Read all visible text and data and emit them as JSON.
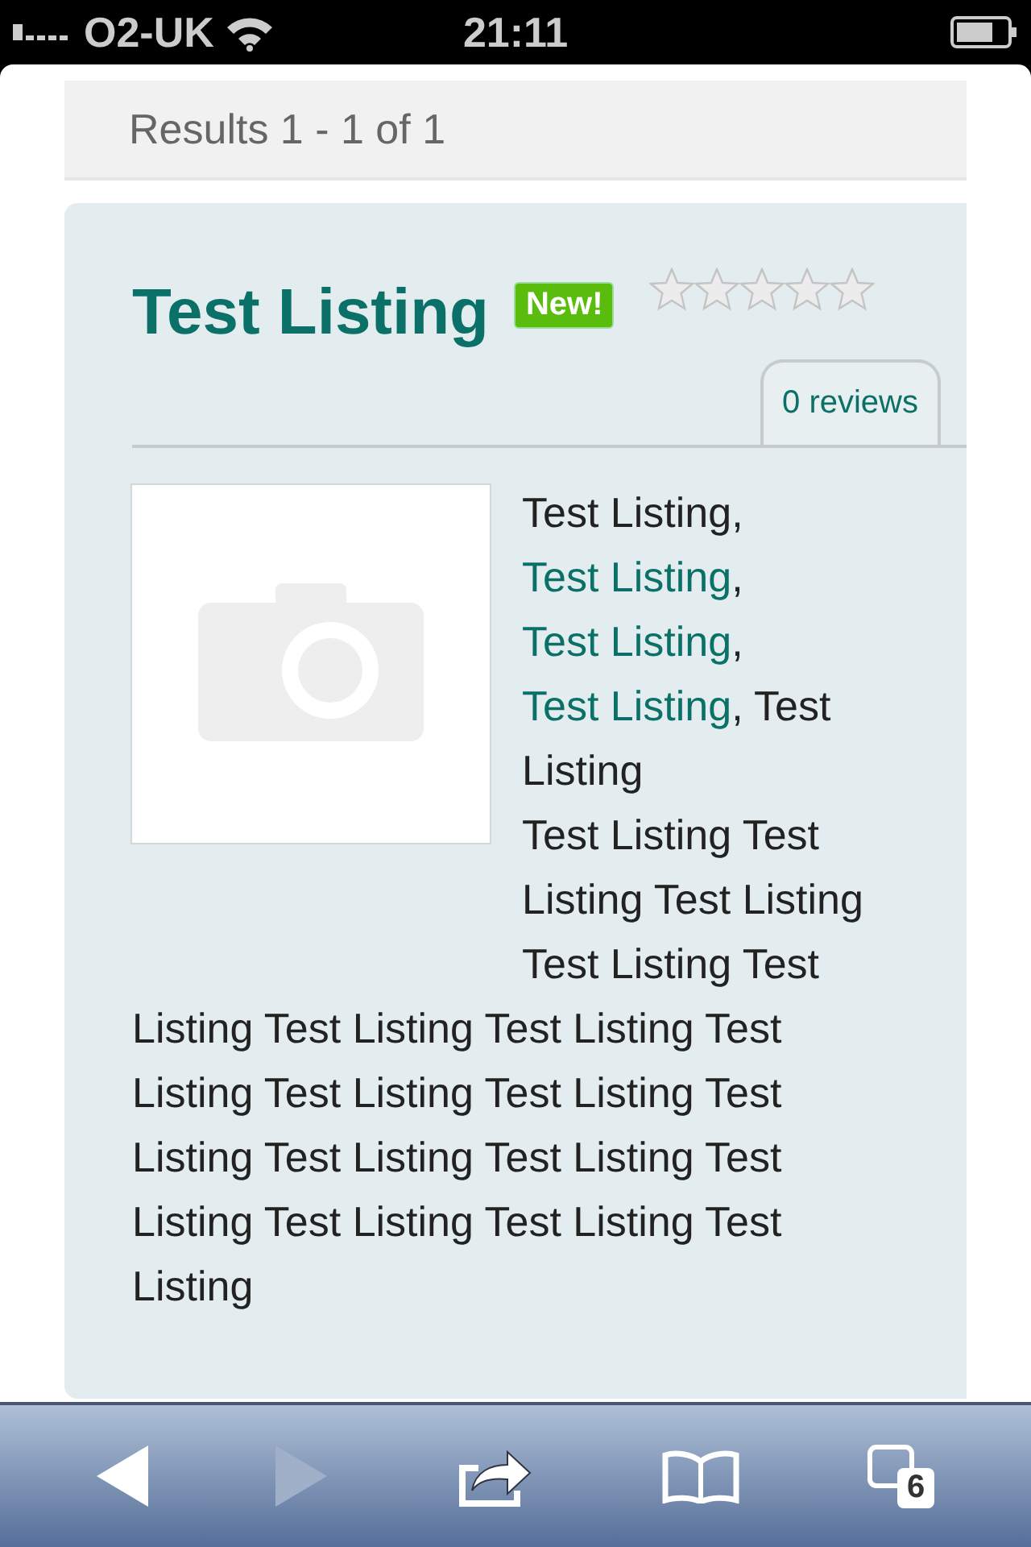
{
  "status_bar": {
    "carrier": "O2-UK",
    "time": "21:11"
  },
  "results": {
    "text": "Results 1 - 1 of 1"
  },
  "listing": {
    "title": "Test Listing",
    "badge": "New!",
    "stars": 0,
    "reviews": "0 reviews",
    "description": [
      {
        "text": "Test Listing, ",
        "link": false
      },
      {
        "text": "Test Listing",
        "link": true
      },
      {
        "text": ", ",
        "link": false
      },
      {
        "text": "Test Listing",
        "link": true
      },
      {
        "text": ", ",
        "link": false
      },
      {
        "text": "Test Listing",
        "link": true
      },
      {
        "text": ", Test Listing",
        "link": false
      }
    ],
    "body": [
      "Test Listing Test Listing Test Listing Test Listing Test",
      "Listing Test Listing Test Listing Test Listing Test Listing Test Listing Test Listing Test Listing Test Listing Test Listing Test Listing Test Listing Test Listing"
    ]
  },
  "toolbar": {
    "back_disabled": false,
    "forward_disabled": true,
    "tab_count": "6"
  }
}
